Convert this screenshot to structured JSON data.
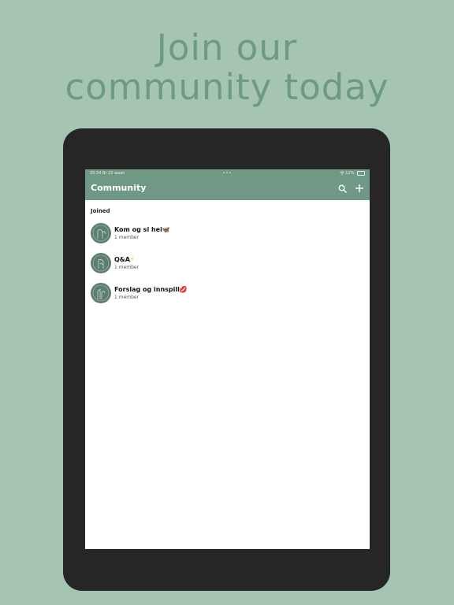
{
  "headline": {
    "line1": "Join our",
    "line2": "community today"
  },
  "status_bar": {
    "time_date": "20:34  Br 22 woan",
    "dots": "•••",
    "battery_text": "12%"
  },
  "app_bar": {
    "title": "Community"
  },
  "section": {
    "label": "Joined"
  },
  "communities": [
    {
      "name": "Kom og si hei",
      "emoji": "🦋",
      "members": "1 member"
    },
    {
      "name": "Q&A",
      "emoji": "⚡",
      "members": "1 member"
    },
    {
      "name": "Forslag og innspill",
      "emoji": "💋",
      "members": "1 member"
    }
  ],
  "colors": {
    "background": "#a5c4b2",
    "accent": "#6f9985",
    "headline": "#6e9a83",
    "tablet": "#262626"
  },
  "icons": [
    "search-icon",
    "plus-icon",
    "wifi-icon",
    "battery-icon"
  ]
}
